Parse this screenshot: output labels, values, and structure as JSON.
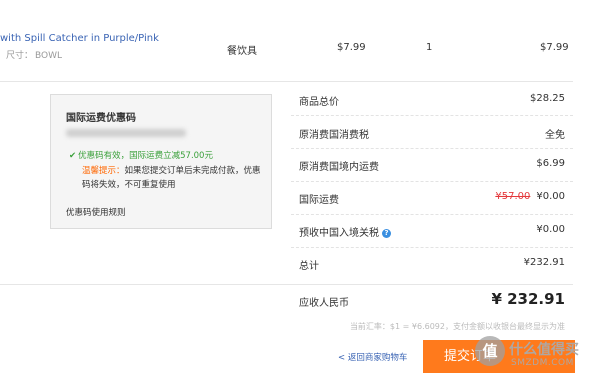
{
  "product": {
    "name": "with Spill Catcher in Purple/Pink",
    "spec_label": "尺寸：",
    "spec_value": "BOWL",
    "category": "餐饮具",
    "unit_price": "$7.99",
    "quantity": "1",
    "subtotal": "$7.99"
  },
  "coupon": {
    "title": "国际运费优惠码",
    "valid_msg": "优惠码有效，国际运费立减57.00元",
    "tip_label": "温馨提示：",
    "tip_text": "如果您提交订单后未完成付款，优惠码将失效，不可重复使用",
    "rules_link": "优惠码使用规则"
  },
  "summary": {
    "goods_total_label": "商品总价",
    "goods_total_value": "$28.25",
    "origin_tax_label": "原消费国消费税",
    "origin_tax_value": "全免",
    "domestic_shipping_label": "原消费国境内运费",
    "domestic_shipping_value": "$6.99",
    "intl_shipping_label": "国际运费",
    "intl_shipping_original": "¥57.00",
    "intl_shipping_value": "¥0.00",
    "import_tax_label": "预收中国入境关税",
    "import_tax_value": "¥0.00",
    "total_label": "总计",
    "total_value": "¥232.91"
  },
  "payable": {
    "label": "应收人民币",
    "amount": "¥ 232.91",
    "rate_note": "当前汇率：$1 = ¥6.6092，支付金额以收银台最终显示为准"
  },
  "actions": {
    "back_link": "< 返回商家购物车",
    "submit_label": "提交订单"
  },
  "watermark": {
    "logo_char": "值",
    "text": "什么值得买",
    "sub": "SMZDM.COM"
  },
  "colors": {
    "accent": "#ff7a1c",
    "link": "#3a64b4",
    "success": "#3aa03a",
    "strike": "#e4393c"
  }
}
